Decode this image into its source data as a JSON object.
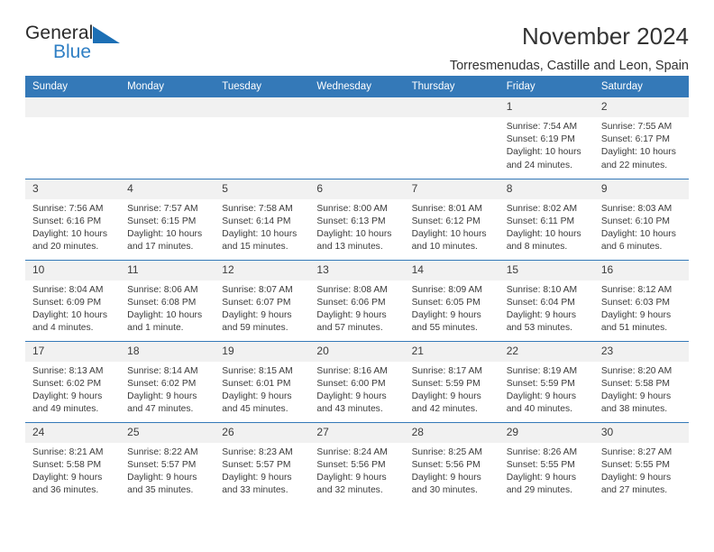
{
  "brand": {
    "name_part1": "General",
    "name_part2": "Blue",
    "triangle_icon": "blue-triangle-logo-mark",
    "accent_color": "#2f7fc4"
  },
  "header": {
    "title": "November 2024",
    "subtitle": "Torresmenudas, Castille and Leon, Spain"
  },
  "calendar": {
    "header_bg_color": "#3479b8",
    "daynum_bg_color": "#f1f1f1",
    "weekday_headers": [
      "Sunday",
      "Monday",
      "Tuesday",
      "Wednesday",
      "Thursday",
      "Friday",
      "Saturday"
    ],
    "weeks": [
      [
        {
          "day": "",
          "sunrise": "",
          "sunset": "",
          "daylight": "",
          "empty": true
        },
        {
          "day": "",
          "sunrise": "",
          "sunset": "",
          "daylight": "",
          "empty": true
        },
        {
          "day": "",
          "sunrise": "",
          "sunset": "",
          "daylight": "",
          "empty": true
        },
        {
          "day": "",
          "sunrise": "",
          "sunset": "",
          "daylight": "",
          "empty": true
        },
        {
          "day": "",
          "sunrise": "",
          "sunset": "",
          "daylight": "",
          "empty": true
        },
        {
          "day": "1",
          "sunrise": "Sunrise: 7:54 AM",
          "sunset": "Sunset: 6:19 PM",
          "daylight": "Daylight: 10 hours and 24 minutes."
        },
        {
          "day": "2",
          "sunrise": "Sunrise: 7:55 AM",
          "sunset": "Sunset: 6:17 PM",
          "daylight": "Daylight: 10 hours and 22 minutes."
        }
      ],
      [
        {
          "day": "3",
          "sunrise": "Sunrise: 7:56 AM",
          "sunset": "Sunset: 6:16 PM",
          "daylight": "Daylight: 10 hours and 20 minutes."
        },
        {
          "day": "4",
          "sunrise": "Sunrise: 7:57 AM",
          "sunset": "Sunset: 6:15 PM",
          "daylight": "Daylight: 10 hours and 17 minutes."
        },
        {
          "day": "5",
          "sunrise": "Sunrise: 7:58 AM",
          "sunset": "Sunset: 6:14 PM",
          "daylight": "Daylight: 10 hours and 15 minutes."
        },
        {
          "day": "6",
          "sunrise": "Sunrise: 8:00 AM",
          "sunset": "Sunset: 6:13 PM",
          "daylight": "Daylight: 10 hours and 13 minutes."
        },
        {
          "day": "7",
          "sunrise": "Sunrise: 8:01 AM",
          "sunset": "Sunset: 6:12 PM",
          "daylight": "Daylight: 10 hours and 10 minutes."
        },
        {
          "day": "8",
          "sunrise": "Sunrise: 8:02 AM",
          "sunset": "Sunset: 6:11 PM",
          "daylight": "Daylight: 10 hours and 8 minutes."
        },
        {
          "day": "9",
          "sunrise": "Sunrise: 8:03 AM",
          "sunset": "Sunset: 6:10 PM",
          "daylight": "Daylight: 10 hours and 6 minutes."
        }
      ],
      [
        {
          "day": "10",
          "sunrise": "Sunrise: 8:04 AM",
          "sunset": "Sunset: 6:09 PM",
          "daylight": "Daylight: 10 hours and 4 minutes."
        },
        {
          "day": "11",
          "sunrise": "Sunrise: 8:06 AM",
          "sunset": "Sunset: 6:08 PM",
          "daylight": "Daylight: 10 hours and 1 minute."
        },
        {
          "day": "12",
          "sunrise": "Sunrise: 8:07 AM",
          "sunset": "Sunset: 6:07 PM",
          "daylight": "Daylight: 9 hours and 59 minutes."
        },
        {
          "day": "13",
          "sunrise": "Sunrise: 8:08 AM",
          "sunset": "Sunset: 6:06 PM",
          "daylight": "Daylight: 9 hours and 57 minutes."
        },
        {
          "day": "14",
          "sunrise": "Sunrise: 8:09 AM",
          "sunset": "Sunset: 6:05 PM",
          "daylight": "Daylight: 9 hours and 55 minutes."
        },
        {
          "day": "15",
          "sunrise": "Sunrise: 8:10 AM",
          "sunset": "Sunset: 6:04 PM",
          "daylight": "Daylight: 9 hours and 53 minutes."
        },
        {
          "day": "16",
          "sunrise": "Sunrise: 8:12 AM",
          "sunset": "Sunset: 6:03 PM",
          "daylight": "Daylight: 9 hours and 51 minutes."
        }
      ],
      [
        {
          "day": "17",
          "sunrise": "Sunrise: 8:13 AM",
          "sunset": "Sunset: 6:02 PM",
          "daylight": "Daylight: 9 hours and 49 minutes."
        },
        {
          "day": "18",
          "sunrise": "Sunrise: 8:14 AM",
          "sunset": "Sunset: 6:02 PM",
          "daylight": "Daylight: 9 hours and 47 minutes."
        },
        {
          "day": "19",
          "sunrise": "Sunrise: 8:15 AM",
          "sunset": "Sunset: 6:01 PM",
          "daylight": "Daylight: 9 hours and 45 minutes."
        },
        {
          "day": "20",
          "sunrise": "Sunrise: 8:16 AM",
          "sunset": "Sunset: 6:00 PM",
          "daylight": "Daylight: 9 hours and 43 minutes."
        },
        {
          "day": "21",
          "sunrise": "Sunrise: 8:17 AM",
          "sunset": "Sunset: 5:59 PM",
          "daylight": "Daylight: 9 hours and 42 minutes."
        },
        {
          "day": "22",
          "sunrise": "Sunrise: 8:19 AM",
          "sunset": "Sunset: 5:59 PM",
          "daylight": "Daylight: 9 hours and 40 minutes."
        },
        {
          "day": "23",
          "sunrise": "Sunrise: 8:20 AM",
          "sunset": "Sunset: 5:58 PM",
          "daylight": "Daylight: 9 hours and 38 minutes."
        }
      ],
      [
        {
          "day": "24",
          "sunrise": "Sunrise: 8:21 AM",
          "sunset": "Sunset: 5:58 PM",
          "daylight": "Daylight: 9 hours and 36 minutes."
        },
        {
          "day": "25",
          "sunrise": "Sunrise: 8:22 AM",
          "sunset": "Sunset: 5:57 PM",
          "daylight": "Daylight: 9 hours and 35 minutes."
        },
        {
          "day": "26",
          "sunrise": "Sunrise: 8:23 AM",
          "sunset": "Sunset: 5:57 PM",
          "daylight": "Daylight: 9 hours and 33 minutes."
        },
        {
          "day": "27",
          "sunrise": "Sunrise: 8:24 AM",
          "sunset": "Sunset: 5:56 PM",
          "daylight": "Daylight: 9 hours and 32 minutes."
        },
        {
          "day": "28",
          "sunrise": "Sunrise: 8:25 AM",
          "sunset": "Sunset: 5:56 PM",
          "daylight": "Daylight: 9 hours and 30 minutes."
        },
        {
          "day": "29",
          "sunrise": "Sunrise: 8:26 AM",
          "sunset": "Sunset: 5:55 PM",
          "daylight": "Daylight: 9 hours and 29 minutes."
        },
        {
          "day": "30",
          "sunrise": "Sunrise: 8:27 AM",
          "sunset": "Sunset: 5:55 PM",
          "daylight": "Daylight: 9 hours and 27 minutes."
        }
      ]
    ]
  }
}
